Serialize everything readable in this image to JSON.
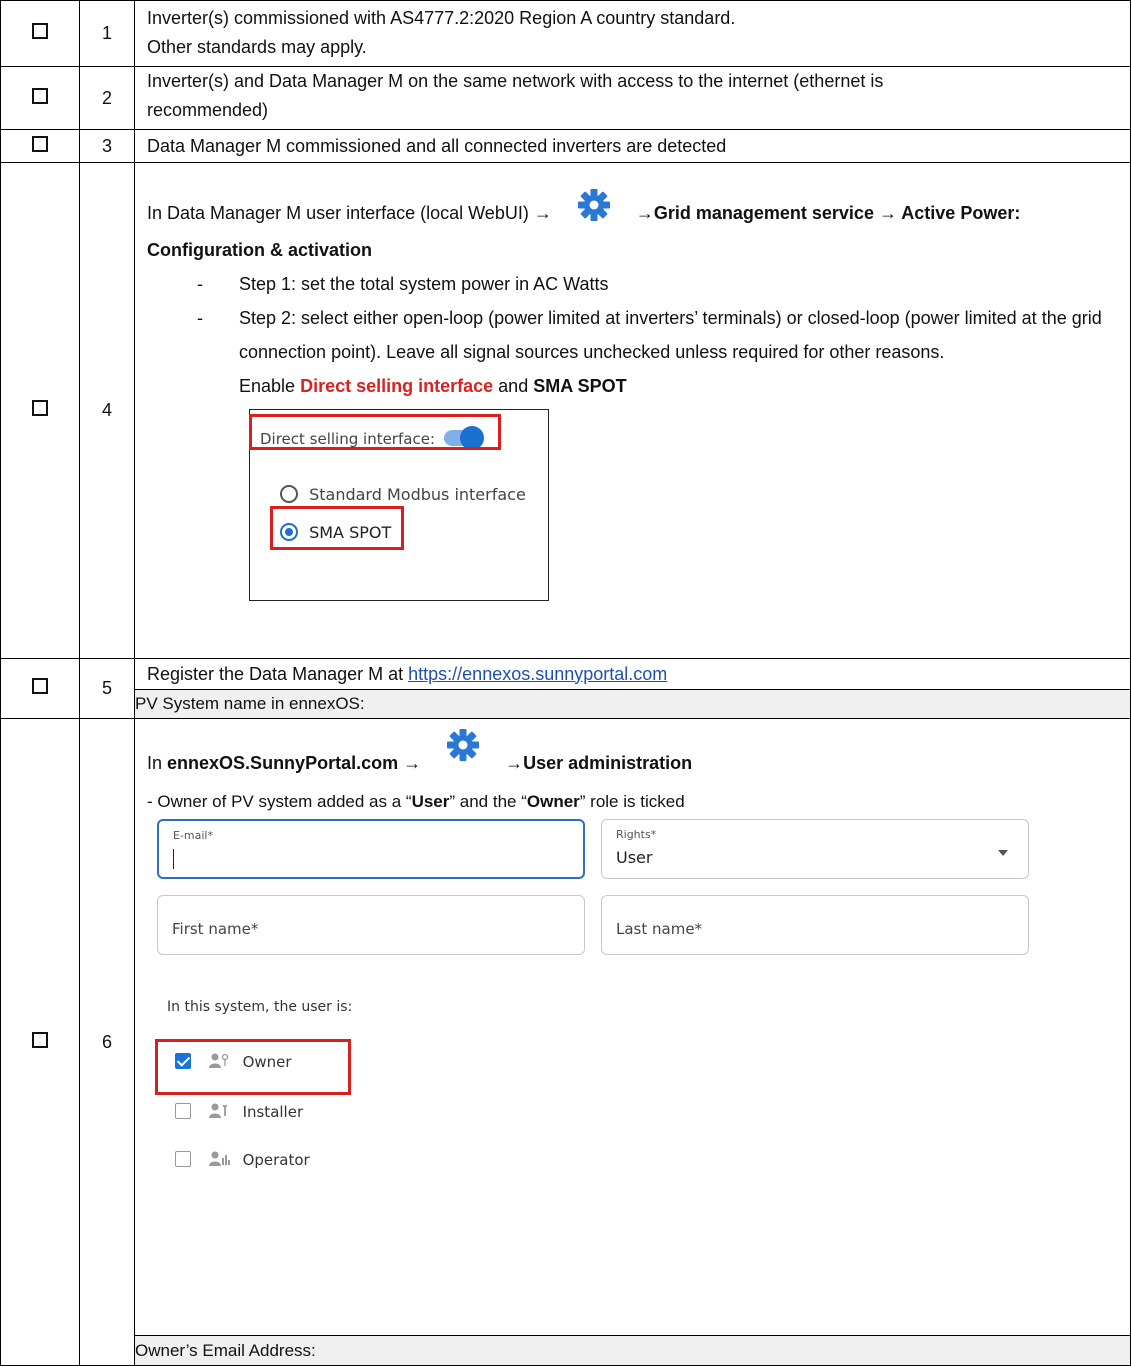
{
  "rows": [
    {
      "num": "1",
      "line1": "Inverter(s) commissioned with AS4777.2:2020 Region A country standard.",
      "line2": "Other standards may apply."
    },
    {
      "num": "2",
      "line1": "Inverter(s) and Data Manager M on the same network with access to the internet (ethernet is",
      "line2": "recommended)"
    },
    {
      "num": "3",
      "line1": "Data Manager M commissioned and all connected inverters are detected"
    },
    {
      "num": "4",
      "intro_text": "In Data Manager M user interface (local WebUI) →",
      "path_bold": "→Grid management service → Active Power: Configuration & activation",
      "step1": "Step 1: set the total system power in AC Watts",
      "step2": "Step 2: select either open-loop (power limited at inverters’ terminals) or closed-loop (power limited at the grid connection point). Leave all signal sources unchecked unless required for other reasons.",
      "enable_prefix": "Enable",
      "enable_red": "Direct selling interface",
      "enable_and": "and",
      "enable_bold": "SMA SPOT",
      "inset": {
        "toggle_label": "Direct selling interface:",
        "option1": "Standard Modbus interface",
        "option2": "SMA SPOT"
      }
    },
    {
      "num": "5",
      "text": "Register the Data Manager M at",
      "link": "https://ennexos.sunnyportal.com",
      "field_label": "PV System name in ennexOS:"
    },
    {
      "num": "6",
      "intro_prefix": "In",
      "intro_bold": "ennexOS.SunnyPortal.com →",
      "path_bold": "→User administration",
      "owner_line_a": "- Owner of PV system added as a “",
      "owner_line_user": "User",
      "owner_line_b": "” and the “",
      "owner_line_owner": "Owner",
      "owner_line_c": "” role is ticked",
      "form": {
        "email_label": "E-mail*",
        "rights_label": "Rights*",
        "rights_value": "User",
        "first_name_placeholder": "First name*",
        "last_name_placeholder": "Last name*",
        "roles_heading": "In this system, the user is:",
        "roles": [
          {
            "label": "Owner",
            "checked": true
          },
          {
            "label": "Installer",
            "checked": false
          },
          {
            "label": "Operator",
            "checked": false
          }
        ]
      },
      "field_label": "Owner’s Email Address:"
    }
  ],
  "colors": {
    "accent_blue": "#1a73d8",
    "highlight_red": "#d82020",
    "field_bg": "#f0f0f0"
  }
}
